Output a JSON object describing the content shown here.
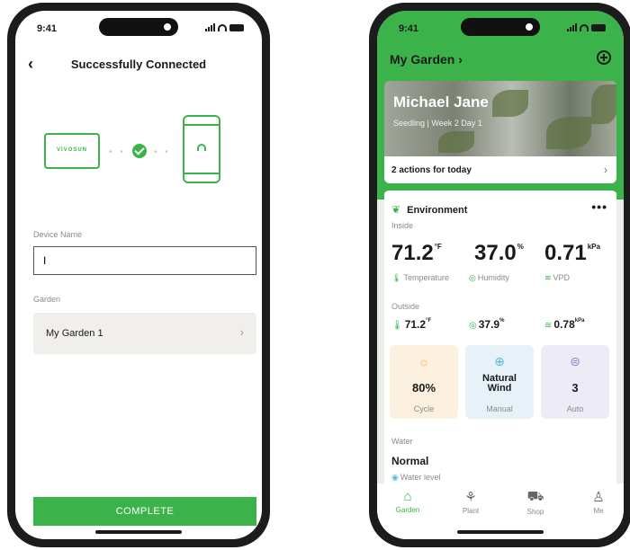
{
  "left_screen": {
    "status_time": "9:41",
    "header_title": "Successfully Connected",
    "back_glyph": "‹",
    "device_brand": "VIVOSUN",
    "device_name_label": "Device Name",
    "device_name_value": "I",
    "garden_label": "Garden",
    "garden_value": "My Garden 1",
    "complete_label": "COMPLETE",
    "accent_color": "#3bb34a"
  },
  "right_screen": {
    "status_time": "9:41",
    "garden_title": "My Garden",
    "title_chevron": "›",
    "user_name": "Michael Jane",
    "plant_stage": "Seedling | Week 2 Day 1",
    "actions_text": "2 actions for today",
    "environment": {
      "title": "Environment",
      "more": "•••",
      "inside_label": "Inside",
      "temperature": {
        "value": "71.2",
        "unit": "°F",
        "label": "Temperature"
      },
      "humidity": {
        "value": "37.0",
        "unit": "%",
        "label": "Humidity"
      },
      "vpd": {
        "value": "0.71",
        "unit": "kPa",
        "label": "VPD"
      },
      "outside_label": "Outside",
      "outside_temperature": {
        "value": "71.2",
        "unit": "°F"
      },
      "outside_humidity": {
        "value": "37.9",
        "unit": "%"
      },
      "outside_vpd": {
        "value": "0.78",
        "unit": "kPa"
      }
    },
    "cards": [
      {
        "icon": "sun-icon",
        "value": "80%",
        "label": "Cycle"
      },
      {
        "icon": "wind-icon",
        "value_line1": "Natural",
        "value_line2": "Wind",
        "label": "Manual"
      },
      {
        "icon": "fan-icon",
        "value": "3",
        "label": "Auto"
      }
    ],
    "water": {
      "label": "Water",
      "status": "Normal",
      "sub_label": "Water level"
    },
    "tabs": [
      {
        "label": "Garden",
        "icon": "home-icon",
        "active": true
      },
      {
        "label": "Plant",
        "icon": "plant-icon",
        "active": false
      },
      {
        "label": "Shop",
        "icon": "cart-icon",
        "active": false
      },
      {
        "label": "Me",
        "icon": "person-icon",
        "active": false
      }
    ]
  }
}
